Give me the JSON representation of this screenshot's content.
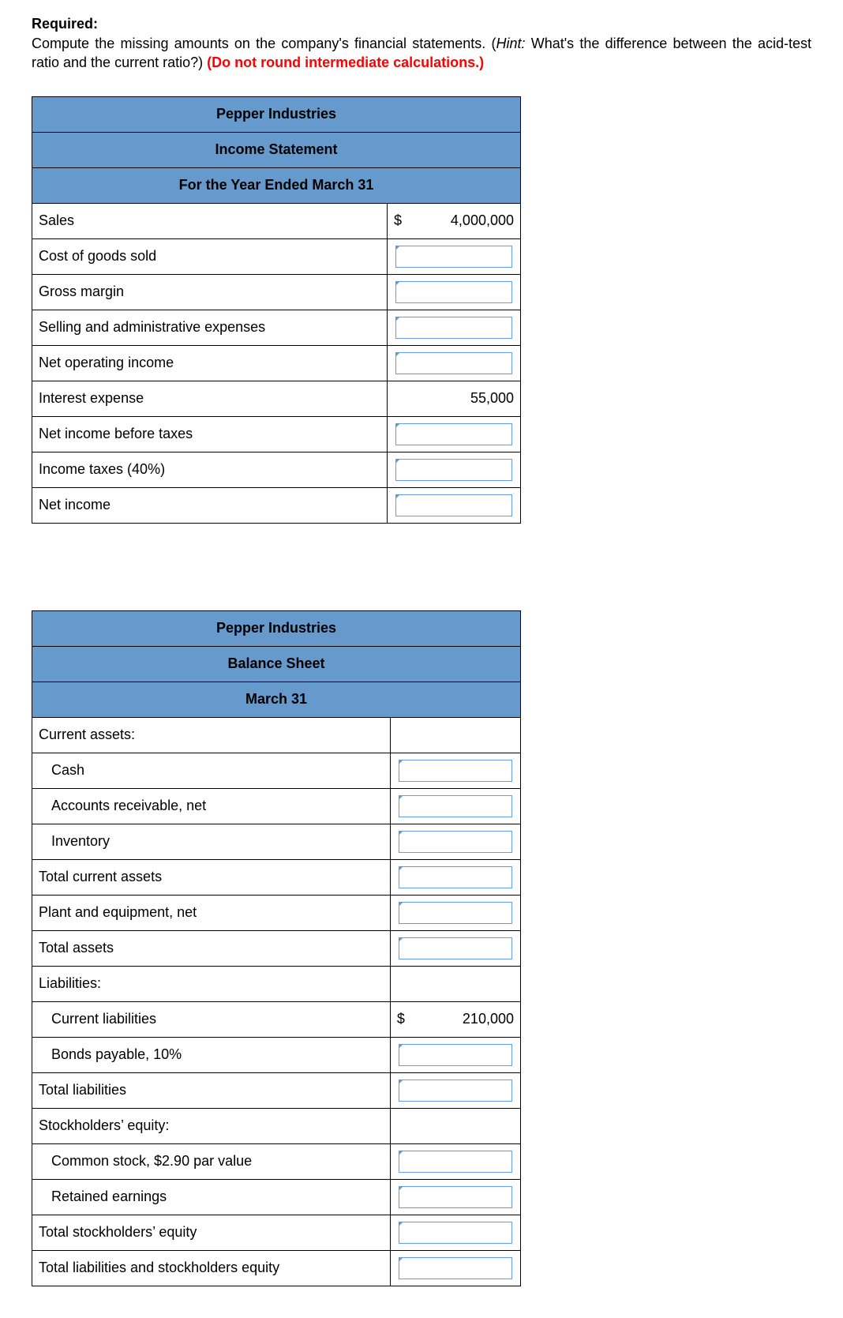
{
  "header": {
    "required_label": "Required:",
    "intro_plain_1": "Compute the missing amounts on the company's financial statements. (",
    "intro_hint_label": "Hint:",
    "intro_plain_2": " What's the difference between the acid-test ratio and the current ratio?) ",
    "intro_warn": "(Do not round intermediate calculations.)"
  },
  "income_statement": {
    "title1": "Pepper Industries",
    "title2": "Income Statement",
    "title3": "For the Year Ended March 31",
    "rows": [
      {
        "label": "Sales",
        "currency": "$",
        "value": "4,000,000",
        "editable": false
      },
      {
        "label": "Cost of goods sold",
        "editable": true
      },
      {
        "label": "Gross margin",
        "editable": true
      },
      {
        "label": "Selling and administrative expenses",
        "editable": true
      },
      {
        "label": "Net operating income",
        "editable": true
      },
      {
        "label": "Interest expense",
        "value": "55,000",
        "editable": false
      },
      {
        "label": "Net income before taxes",
        "editable": true
      },
      {
        "label": "Income taxes (40%)",
        "editable": true
      },
      {
        "label": "Net income",
        "editable": true
      }
    ]
  },
  "balance_sheet": {
    "title1": "Pepper Industries",
    "title2": "Balance Sheet",
    "title3": "March 31",
    "rows": [
      {
        "label": "Current assets:",
        "indent": 0,
        "blank": true
      },
      {
        "label": "Cash",
        "indent": 1,
        "editable": true
      },
      {
        "label": "Accounts receivable, net",
        "indent": 1,
        "editable": true
      },
      {
        "label": "Inventory",
        "indent": 1,
        "editable": true
      },
      {
        "label": "Total current assets",
        "indent": 0,
        "editable": true
      },
      {
        "label": "Plant and equipment, net",
        "indent": 0,
        "editable": true
      },
      {
        "label": "Total assets",
        "indent": 0,
        "editable": true
      },
      {
        "label": "Liabilities:",
        "indent": 0,
        "blank": true
      },
      {
        "label": "Current liabilities",
        "indent": 1,
        "currency": "$",
        "value": "210,000",
        "editable": false
      },
      {
        "label": "Bonds payable, 10%",
        "indent": 1,
        "editable": true
      },
      {
        "label": "Total liabilities",
        "indent": 0,
        "editable": true
      },
      {
        "label": "Stockholders’ equity:",
        "indent": 0,
        "blank": true
      },
      {
        "label": "Common stock, $2.90 par value",
        "indent": 1,
        "editable": true
      },
      {
        "label": "Retained earnings",
        "indent": 1,
        "editable": true
      },
      {
        "label": "Total stockholders’ equity",
        "indent": 0,
        "editable": true
      },
      {
        "label": "Total liabilities and stockholders equity",
        "indent": 0,
        "editable": true
      }
    ]
  }
}
